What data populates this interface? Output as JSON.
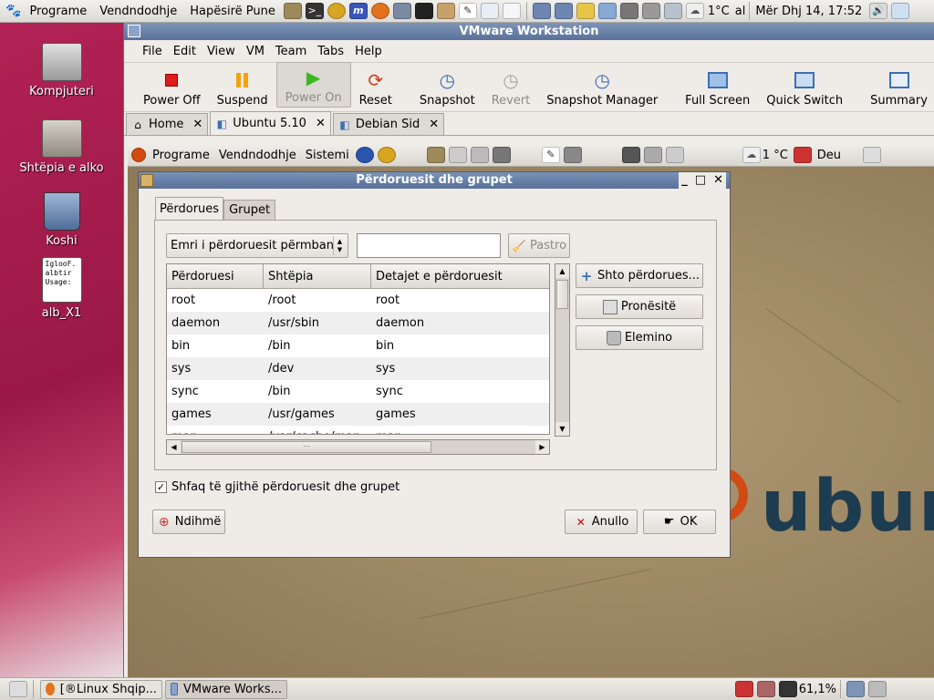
{
  "top_panel": {
    "menus": [
      "Programe",
      "Vendndodhje",
      "Hapësirë Pune"
    ],
    "weather": "1°C",
    "weather_suffix": "al",
    "clock": "Mër Dhj 14, 17:52"
  },
  "desktop": {
    "icons": [
      {
        "label": "Kompjuteri",
        "icon": "computer-icon"
      },
      {
        "label": "Shtëpia e alko",
        "icon": "home-folder-icon"
      },
      {
        "label": "Koshi",
        "icon": "trash-icon"
      },
      {
        "label": "alb_X1",
        "icon": "text-file-icon",
        "preview_lines": [
          "IglooF.",
          "albtir",
          "Usage:"
        ]
      }
    ]
  },
  "vmware": {
    "title": "VMware Workstation",
    "menus": [
      "File",
      "Edit",
      "View",
      "VM",
      "Team",
      "Tabs",
      "Help"
    ],
    "toolbar": [
      {
        "label": "Power Off",
        "icon": "power-off-icon",
        "state": "normal"
      },
      {
        "label": "Suspend",
        "icon": "suspend-icon",
        "state": "normal"
      },
      {
        "label": "Power On",
        "icon": "power-on-icon",
        "state": "pressed"
      },
      {
        "label": "Reset",
        "icon": "reset-icon",
        "state": "normal"
      },
      {
        "label": "Snapshot",
        "icon": "snapshot-icon",
        "state": "normal"
      },
      {
        "label": "Revert",
        "icon": "revert-icon",
        "state": "disabled"
      },
      {
        "label": "Snapshot Manager",
        "icon": "snapshot-manager-icon",
        "state": "normal"
      },
      {
        "label": "Full Screen",
        "icon": "full-screen-icon",
        "state": "normal"
      },
      {
        "label": "Quick Switch",
        "icon": "quick-switch-icon",
        "state": "normal"
      },
      {
        "label": "Summary",
        "icon": "summary-icon",
        "state": "normal"
      }
    ],
    "tabs": [
      {
        "label": "Home",
        "active": false
      },
      {
        "label": "Ubuntu 5.10",
        "active": true
      },
      {
        "label": "Debian Sid",
        "active": false
      }
    ]
  },
  "guest_panel": {
    "menus": [
      "Programe",
      "Vendndodhje",
      "Sistemi"
    ],
    "weather": "1 °C",
    "locale": "Deu"
  },
  "guest_wallpaper": {
    "logo_text": "ubun"
  },
  "dialog": {
    "title": "Përdoruesit dhe grupet",
    "tabs": [
      "Përdorues",
      "Grupet"
    ],
    "search_combo": "Emri i përdoruesit përmban",
    "search_value": "",
    "clear_button": "Pastro",
    "columns": [
      "Përdoruesi",
      "Shtëpia",
      "Detajet e përdoruesit"
    ],
    "rows": [
      [
        "root",
        "/root",
        "root"
      ],
      [
        "daemon",
        "/usr/sbin",
        "daemon"
      ],
      [
        "bin",
        "/bin",
        "bin"
      ],
      [
        "sys",
        "/dev",
        "sys"
      ],
      [
        "sync",
        "/bin",
        "sync"
      ],
      [
        "games",
        "/usr/games",
        "games"
      ],
      [
        "man",
        "/var/cache/man",
        "man"
      ]
    ],
    "add_button": "Shto përdorues...",
    "properties_button": "Pronësitë",
    "delete_button": "Elemino",
    "show_all_label": "Shfaq të gjithë përdoruesit dhe grupet",
    "show_all_checked": true,
    "help_button": "Ndihmë",
    "cancel_button": "Anullo",
    "ok_button": "OK"
  },
  "bottom_panel": {
    "tasks": [
      {
        "label": "[®Linux Shqip...",
        "active": false
      },
      {
        "label": "VMware Works...",
        "active": true
      }
    ],
    "battery": "61,1%"
  }
}
